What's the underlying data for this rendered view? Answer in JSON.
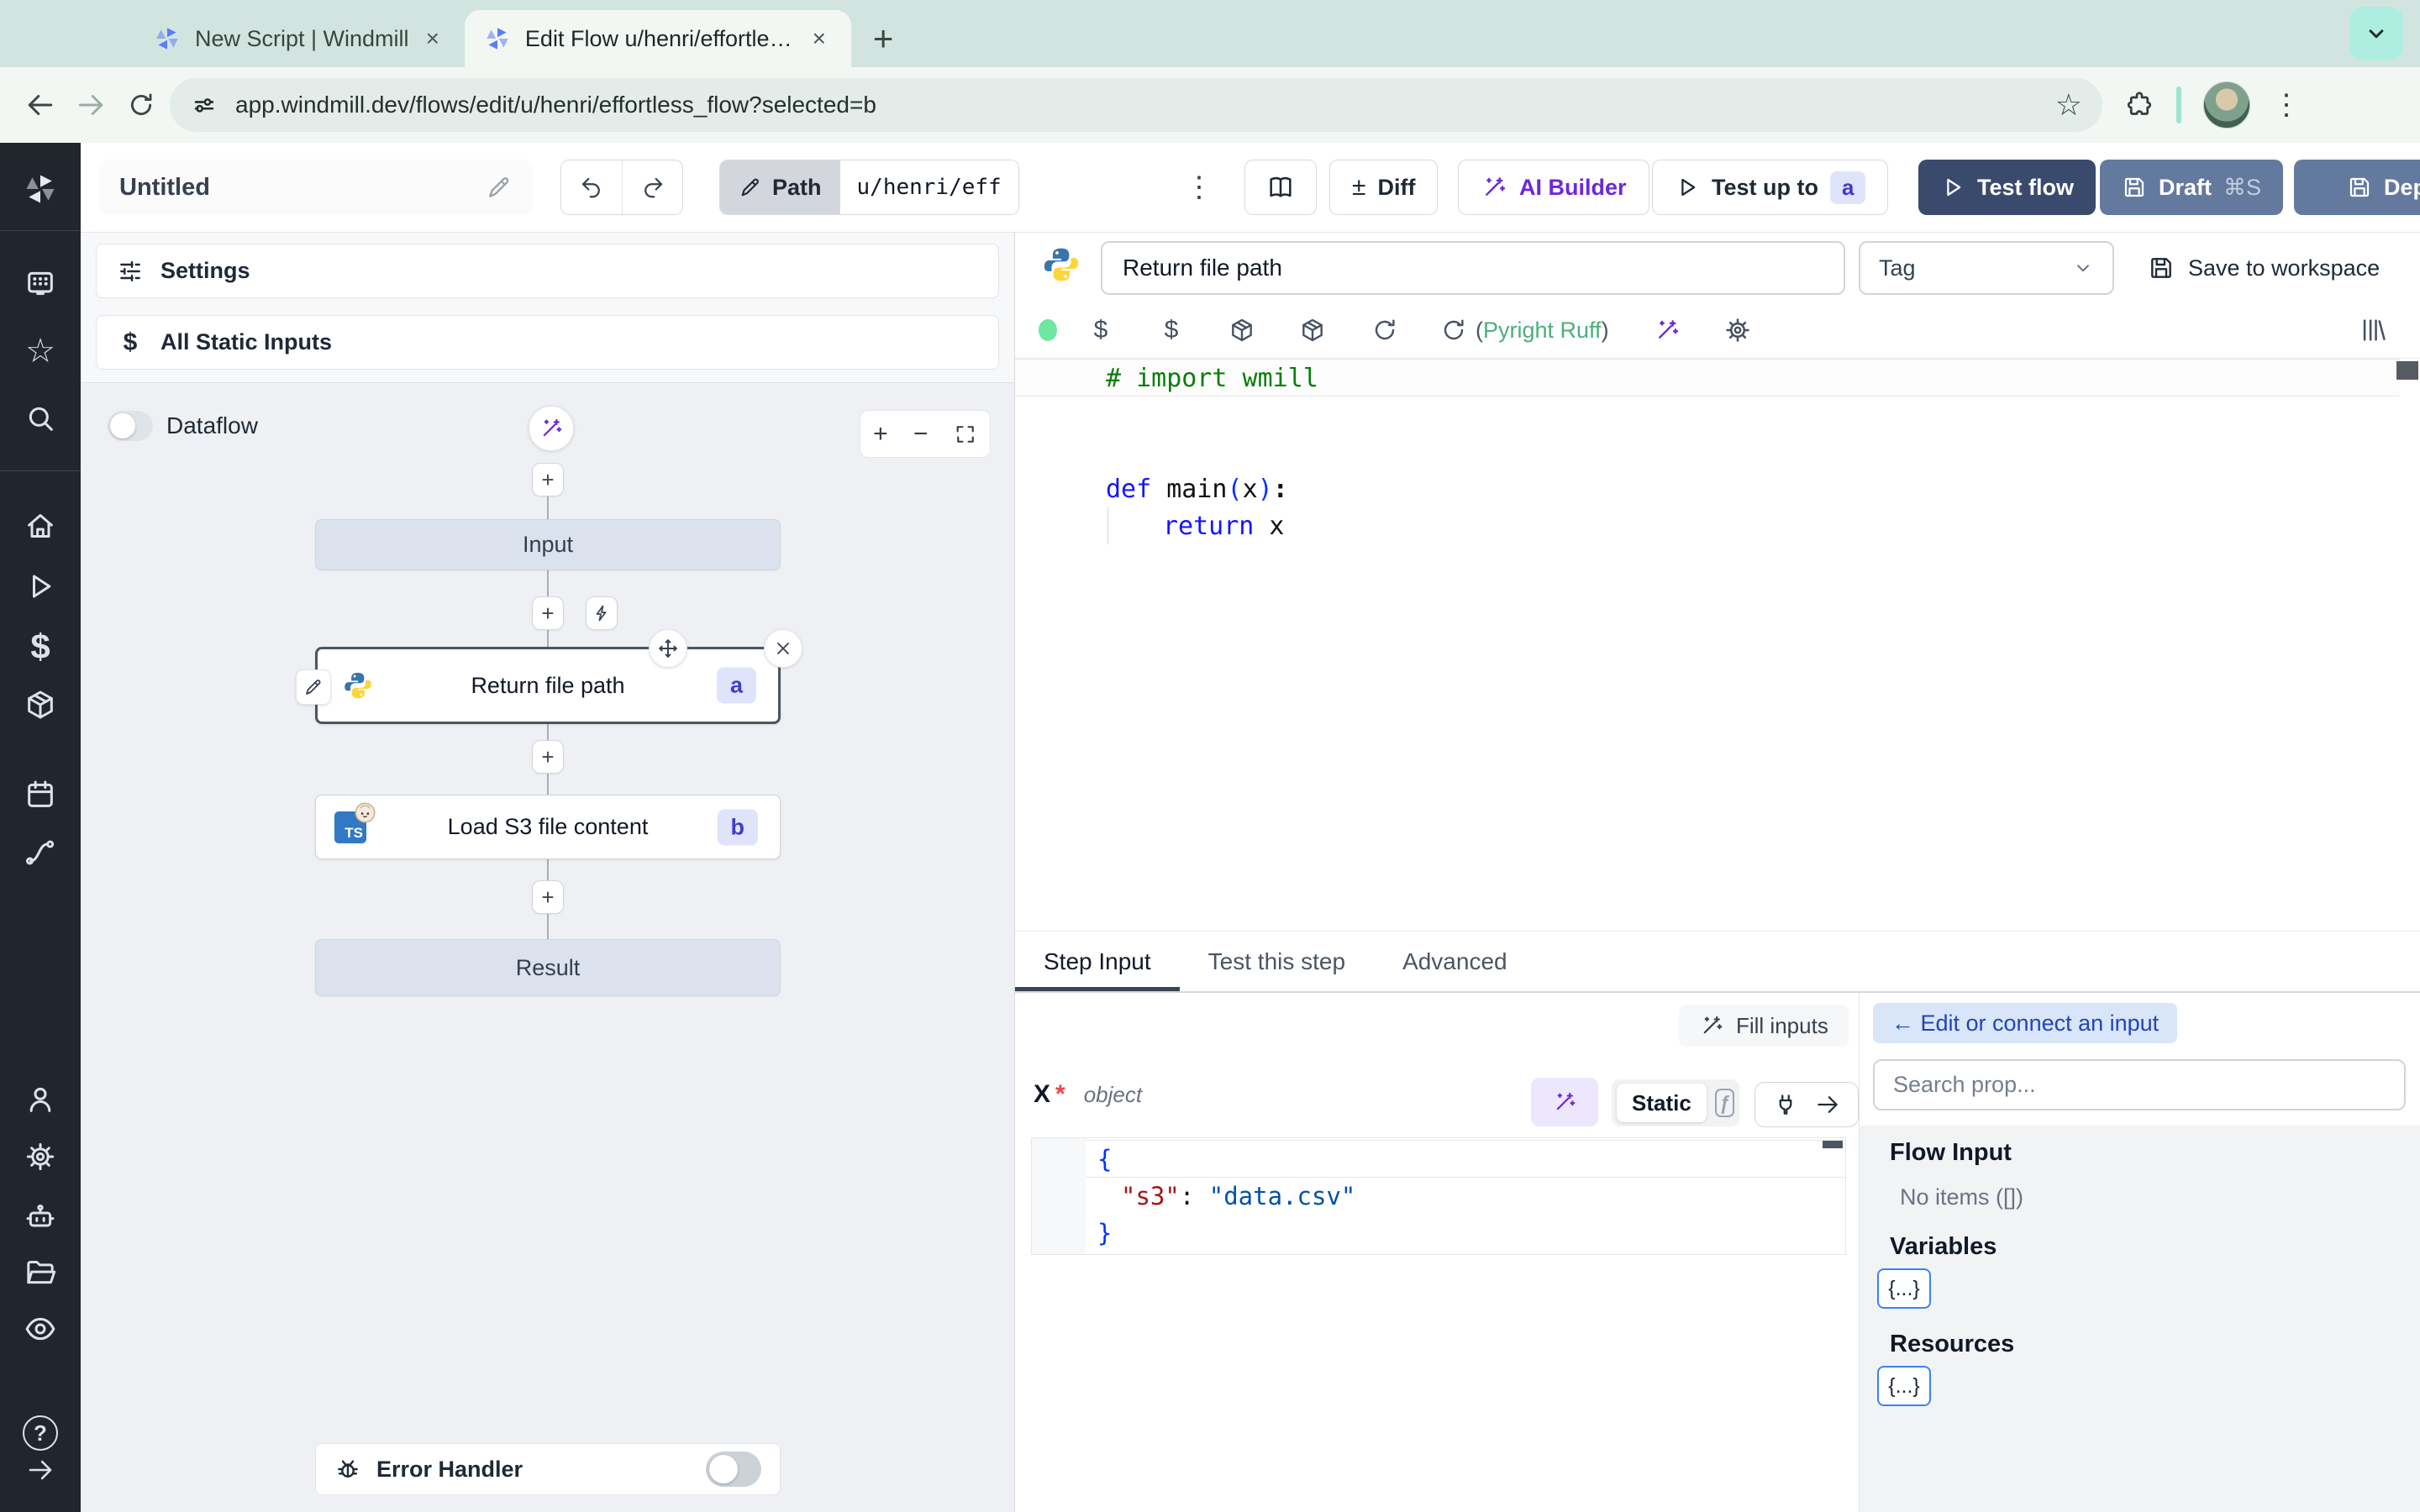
{
  "browser": {
    "tab1_label": "New Script | Windmill",
    "tab2_label": "Edit Flow u/henri/effortless_fl",
    "url": "app.windmill.dev/flows/edit/u/henri/effortless_flow?selected=b"
  },
  "toolbar": {
    "title": "Untitled",
    "path_label": "Path",
    "path_value": "u/henri/eff",
    "diff_label": "Diff",
    "ai_builder_label": "AI Builder",
    "test_up_to_label": "Test up to",
    "test_up_to_badge": "a",
    "test_flow_label": "Test flow",
    "draft_label": "Draft",
    "draft_shortcut": "⌘S",
    "deploy_label": "Deploy"
  },
  "flow_panel": {
    "settings_label": "Settings",
    "static_inputs_label": "All Static Inputs",
    "dataflow_label": "Dataflow",
    "nodes": {
      "input": {
        "label": "Input"
      },
      "step_a": {
        "label": "Return file path",
        "badge": "a"
      },
      "step_b": {
        "label": "Load S3 file content",
        "badge": "b",
        "lang_badge": "TS"
      },
      "result": {
        "label": "Result"
      }
    },
    "error_handler_label": "Error Handler"
  },
  "editor": {
    "step_name": "Return file path",
    "tag_placeholder": "Tag",
    "save_to_workspace_label": "Save to workspace",
    "lint": {
      "open": "(",
      "text": "Pyright Ruff",
      "close": ")"
    },
    "code": {
      "comment": "# import wmill",
      "kw_def": "def",
      "fn_name": " main",
      "paren_open": "(",
      "arg": "x",
      "paren_close": ")",
      "colon": ":",
      "kw_return": "return",
      "return_arg": " x"
    }
  },
  "bottom": {
    "tabs": {
      "step_input": "Step Input",
      "test_this_step": "Test this step",
      "advanced": "Advanced"
    },
    "fill_inputs_label": "Fill inputs",
    "arg": {
      "name": "X",
      "required": "*",
      "type": "object"
    },
    "static_label": "Static",
    "json": {
      "open": "{",
      "key": "\"s3\"",
      "colon": ": ",
      "value": "\"data.csv\"",
      "close": "}"
    }
  },
  "right_panel": {
    "edit_connect_label": "← Edit or connect an input",
    "search_placeholder": "Search prop...",
    "flow_input_heading": "Flow Input",
    "no_items_text": "No items ([])",
    "variables_heading": "Variables",
    "resources_heading": "Resources",
    "braces": "{...}"
  },
  "glyphs": {
    "plus": "+",
    "minus": "−",
    "kebab": "⋮",
    "plus_minus": "±",
    "dollar": "$",
    "star": "☆",
    "close": "×",
    "question": "?",
    "fx": "ƒ",
    "new_tab": "+"
  },
  "colors": {
    "primary_button": "#3a4a6d",
    "secondary_button": "#64799e",
    "ai_purple": "#6d28d9",
    "badge_bg": "#e0e4fb",
    "badge_text": "#4338ca",
    "lint_green": "#4caf7d",
    "link_blue": "#2145b8",
    "chip_border_blue": "#3b82f6",
    "code_comment": "#0a7d0a",
    "code_keyword": "#1414ff",
    "code_string": "#0451a5",
    "code_key": "#a31515",
    "chrome_mint": "#aeeee0",
    "sidebar_dark": "#21252e",
    "node_virtual_bg": "#dbe2ed"
  },
  "icons": [
    "windmill-logo",
    "pencil",
    "undo",
    "redo",
    "book",
    "diff-plus-minus",
    "wand",
    "play",
    "save",
    "sliders",
    "dollar",
    "cube",
    "refresh",
    "gear",
    "library",
    "plug",
    "arrow-right",
    "bolt",
    "move",
    "close",
    "bug",
    "search",
    "home",
    "calendar",
    "user",
    "eye",
    "folder",
    "robot",
    "workspace-card",
    "flow-squiggle",
    "puzzle",
    "site-info",
    "chevron-down",
    "expand",
    "python-logo",
    "typescript-logo",
    "bun-logo",
    "help",
    "bookmark-star",
    "extensions-puzzle",
    "avatar",
    "menu-kebab"
  ]
}
